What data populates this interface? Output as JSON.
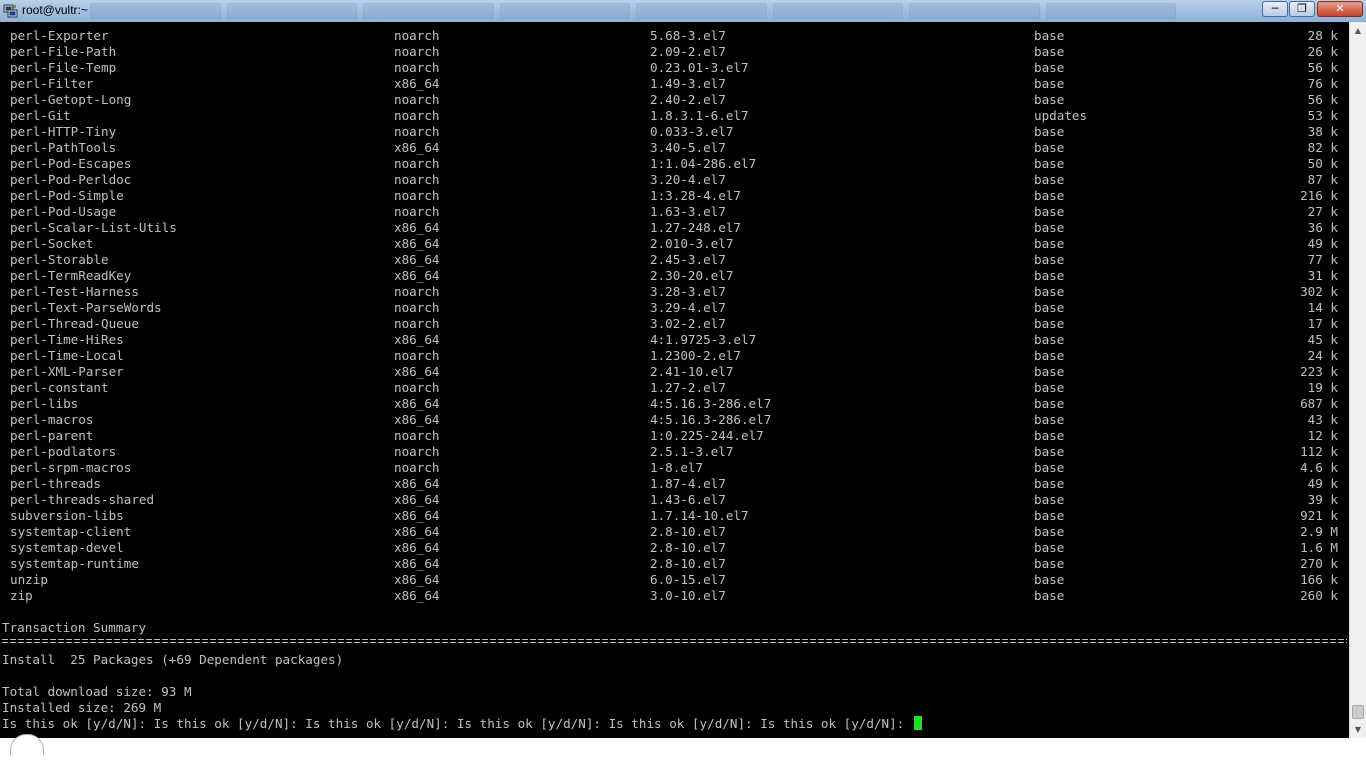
{
  "window": {
    "title": "root@vultr:~",
    "icon": "putty-icon",
    "controls": {
      "minimize": "minimize-icon",
      "maximize": "maximize-icon",
      "close": "close-icon"
    }
  },
  "terminal": {
    "packages": [
      {
        "name": "perl-Exporter",
        "arch": "noarch",
        "version": "5.68-3.el7",
        "repo": "base",
        "size": "28 k"
      },
      {
        "name": "perl-File-Path",
        "arch": "noarch",
        "version": "2.09-2.el7",
        "repo": "base",
        "size": "26 k"
      },
      {
        "name": "perl-File-Temp",
        "arch": "noarch",
        "version": "0.23.01-3.el7",
        "repo": "base",
        "size": "56 k"
      },
      {
        "name": "perl-Filter",
        "arch": "x86_64",
        "version": "1.49-3.el7",
        "repo": "base",
        "size": "76 k"
      },
      {
        "name": "perl-Getopt-Long",
        "arch": "noarch",
        "version": "2.40-2.el7",
        "repo": "base",
        "size": "56 k"
      },
      {
        "name": "perl-Git",
        "arch": "noarch",
        "version": "1.8.3.1-6.el7",
        "repo": "updates",
        "size": "53 k"
      },
      {
        "name": "perl-HTTP-Tiny",
        "arch": "noarch",
        "version": "0.033-3.el7",
        "repo": "base",
        "size": "38 k"
      },
      {
        "name": "perl-PathTools",
        "arch": "x86_64",
        "version": "3.40-5.el7",
        "repo": "base",
        "size": "82 k"
      },
      {
        "name": "perl-Pod-Escapes",
        "arch": "noarch",
        "version": "1:1.04-286.el7",
        "repo": "base",
        "size": "50 k"
      },
      {
        "name": "perl-Pod-Perldoc",
        "arch": "noarch",
        "version": "3.20-4.el7",
        "repo": "base",
        "size": "87 k"
      },
      {
        "name": "perl-Pod-Simple",
        "arch": "noarch",
        "version": "1:3.28-4.el7",
        "repo": "base",
        "size": "216 k"
      },
      {
        "name": "perl-Pod-Usage",
        "arch": "noarch",
        "version": "1.63-3.el7",
        "repo": "base",
        "size": "27 k"
      },
      {
        "name": "perl-Scalar-List-Utils",
        "arch": "x86_64",
        "version": "1.27-248.el7",
        "repo": "base",
        "size": "36 k"
      },
      {
        "name": "perl-Socket",
        "arch": "x86_64",
        "version": "2.010-3.el7",
        "repo": "base",
        "size": "49 k"
      },
      {
        "name": "perl-Storable",
        "arch": "x86_64",
        "version": "2.45-3.el7",
        "repo": "base",
        "size": "77 k"
      },
      {
        "name": "perl-TermReadKey",
        "arch": "x86_64",
        "version": "2.30-20.el7",
        "repo": "base",
        "size": "31 k"
      },
      {
        "name": "perl-Test-Harness",
        "arch": "noarch",
        "version": "3.28-3.el7",
        "repo": "base",
        "size": "302 k"
      },
      {
        "name": "perl-Text-ParseWords",
        "arch": "noarch",
        "version": "3.29-4.el7",
        "repo": "base",
        "size": "14 k"
      },
      {
        "name": "perl-Thread-Queue",
        "arch": "noarch",
        "version": "3.02-2.el7",
        "repo": "base",
        "size": "17 k"
      },
      {
        "name": "perl-Time-HiRes",
        "arch": "x86_64",
        "version": "4:1.9725-3.el7",
        "repo": "base",
        "size": "45 k"
      },
      {
        "name": "perl-Time-Local",
        "arch": "noarch",
        "version": "1.2300-2.el7",
        "repo": "base",
        "size": "24 k"
      },
      {
        "name": "perl-XML-Parser",
        "arch": "x86_64",
        "version": "2.41-10.el7",
        "repo": "base",
        "size": "223 k"
      },
      {
        "name": "perl-constant",
        "arch": "noarch",
        "version": "1.27-2.el7",
        "repo": "base",
        "size": "19 k"
      },
      {
        "name": "perl-libs",
        "arch": "x86_64",
        "version": "4:5.16.3-286.el7",
        "repo": "base",
        "size": "687 k"
      },
      {
        "name": "perl-macros",
        "arch": "x86_64",
        "version": "4:5.16.3-286.el7",
        "repo": "base",
        "size": "43 k"
      },
      {
        "name": "perl-parent",
        "arch": "noarch",
        "version": "1:0.225-244.el7",
        "repo": "base",
        "size": "12 k"
      },
      {
        "name": "perl-podlators",
        "arch": "noarch",
        "version": "2.5.1-3.el7",
        "repo": "base",
        "size": "112 k"
      },
      {
        "name": "perl-srpm-macros",
        "arch": "noarch",
        "version": "1-8.el7",
        "repo": "base",
        "size": "4.6 k"
      },
      {
        "name": "perl-threads",
        "arch": "x86_64",
        "version": "1.87-4.el7",
        "repo": "base",
        "size": "49 k"
      },
      {
        "name": "perl-threads-shared",
        "arch": "x86_64",
        "version": "1.43-6.el7",
        "repo": "base",
        "size": "39 k"
      },
      {
        "name": "subversion-libs",
        "arch": "x86_64",
        "version": "1.7.14-10.el7",
        "repo": "base",
        "size": "921 k"
      },
      {
        "name": "systemtap-client",
        "arch": "x86_64",
        "version": "2.8-10.el7",
        "repo": "base",
        "size": "2.9 M"
      },
      {
        "name": "systemtap-devel",
        "arch": "x86_64",
        "version": "2.8-10.el7",
        "repo": "base",
        "size": "1.6 M"
      },
      {
        "name": "systemtap-runtime",
        "arch": "x86_64",
        "version": "2.8-10.el7",
        "repo": "base",
        "size": "270 k"
      },
      {
        "name": "unzip",
        "arch": "x86_64",
        "version": "6.0-15.el7",
        "repo": "base",
        "size": "166 k"
      },
      {
        "name": "zip",
        "arch": "x86_64",
        "version": "3.0-10.el7",
        "repo": "base",
        "size": "260 k"
      }
    ],
    "summary_heading": "Transaction Summary",
    "install_line": "Install  25 Packages (+69 Dependent packages)",
    "download_size": "Total download size: 93 M",
    "installed_size": "Installed size: 269 M",
    "prompt": "Is this ok [y/d/N]: Is this ok [y/d/N]: Is this ok [y/d/N]: Is this ok [y/d/N]: Is this ok [y/d/N]: Is this ok [y/d/N]: ",
    "cursor_color": "#22dd22"
  },
  "scrollbar": {
    "up_icon": "scroll-up-icon",
    "down_icon": "scroll-down-icon"
  }
}
